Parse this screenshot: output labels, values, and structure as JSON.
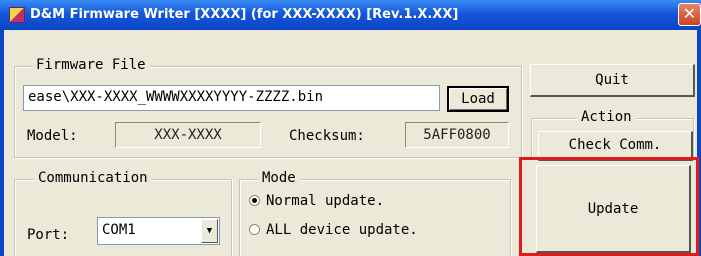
{
  "window": {
    "title": "D&M Firmware Writer [XXXX] (for XXX-XXXX) [Rev.1.X.XX]",
    "close_glyph": "✕",
    "app_icon": "dm-app-icon",
    "title_bar_color": "#0a45c6"
  },
  "firmware": {
    "group_label": "Firmware File",
    "path_value": "ease\\XXX-XXXX_WWWWXXXXYYYY-ZZZZ.bin",
    "load_label": "Load",
    "model_label": "Model:",
    "model_value": "XXX-XXXX",
    "checksum_label": "Checksum:",
    "checksum_value": "5AFF0800"
  },
  "buttons": {
    "quit_label": "Quit",
    "action_group_label": "Action",
    "check_comm_label": "Check Comm.",
    "update_label": "Update"
  },
  "communication": {
    "group_label": "Communication",
    "port_label": "Port:",
    "port_value": "COM1"
  },
  "mode": {
    "group_label": "Mode",
    "options": [
      {
        "label": "Normal update.",
        "selected": true
      },
      {
        "label": "ALL device update.",
        "selected": false
      }
    ]
  },
  "annotation": {
    "highlight_color": "#e01b1b"
  }
}
